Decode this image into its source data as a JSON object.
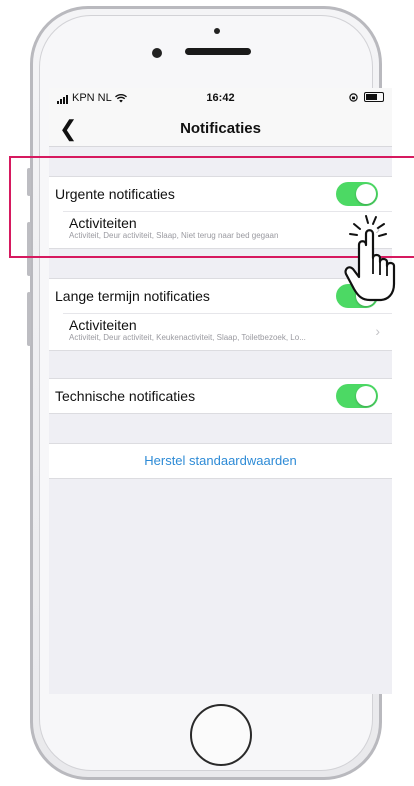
{
  "status": {
    "carrier": "KPN NL",
    "time": "16:42"
  },
  "nav": {
    "title": "Notificaties"
  },
  "sections": [
    {
      "title": "Urgente notificaties",
      "enabled": true,
      "sub_title": "Activiteiten",
      "sub_desc": "Activiteit, Deur activiteit, Slaap, Niet terug naar bed gegaan"
    },
    {
      "title": "Lange termijn notificaties",
      "enabled": true,
      "sub_title": "Activiteiten",
      "sub_desc": "Activiteit, Deur activiteit, Keukenactiviteit, Slaap, Toiletbezoek, Lo..."
    },
    {
      "title": "Technische notificaties",
      "enabled": true
    }
  ],
  "reset_label": "Herstel standaardwaarden",
  "colors": {
    "toggle_on": "#4cd964",
    "link": "#2e8bd6",
    "highlight": "#d6195f"
  },
  "icons": [
    "back-chevron",
    "wifi",
    "battery",
    "chevron-right",
    "hand-pointer-tap"
  ]
}
